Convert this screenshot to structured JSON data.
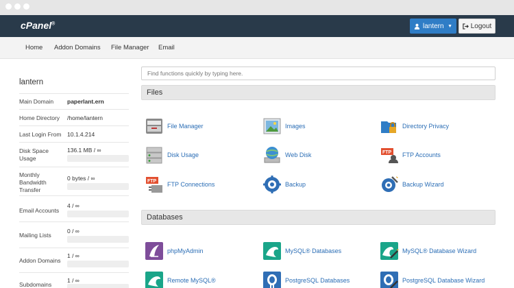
{
  "brand": {
    "logo": "cPanel",
    "mark": "®"
  },
  "header": {
    "username": "lantern",
    "logout_label": "Logout"
  },
  "nav": [
    "Home",
    "Addon Domains",
    "File Manager",
    "Email"
  ],
  "sidebar": {
    "username": "lantern",
    "stats": [
      {
        "label": "Main Domain",
        "value": "paperlant.ern",
        "bold": true
      },
      {
        "label": "Home Directory",
        "value": "/home/lantern"
      },
      {
        "label": "Last Login From",
        "value": "10.1.4.214"
      },
      {
        "label": "Disk Space Usage",
        "value": "136.1 MB / ∞",
        "usage": 0
      },
      {
        "label": "Monthly Bandwidth Transfer",
        "value": "0 bytes / ∞",
        "usage": 0
      },
      {
        "label": "Email Accounts",
        "value": "4 / ∞",
        "usage": 0
      },
      {
        "label": "Mailing Lists",
        "value": "0 / ∞",
        "usage": 0
      },
      {
        "label": "Addon Domains",
        "value": "1 / ∞",
        "usage": 0
      },
      {
        "label": "Subdomains",
        "value": "1 / ∞",
        "usage": 0
      }
    ]
  },
  "search": {
    "placeholder": "Find functions quickly by typing here."
  },
  "sections": {
    "files": {
      "title": "Files",
      "items": [
        {
          "label": "File Manager",
          "icon": "file-manager-icon"
        },
        {
          "label": "Images",
          "icon": "images-icon"
        },
        {
          "label": "Directory Privacy",
          "icon": "directory-privacy-icon"
        },
        {
          "label": "Disk Usage",
          "icon": "disk-usage-icon"
        },
        {
          "label": "Web Disk",
          "icon": "web-disk-icon"
        },
        {
          "label": "FTP Accounts",
          "icon": "ftp-accounts-icon"
        },
        {
          "label": "FTP Connections",
          "icon": "ftp-connections-icon"
        },
        {
          "label": "Backup",
          "icon": "backup-icon"
        },
        {
          "label": "Backup Wizard",
          "icon": "backup-wizard-icon"
        }
      ]
    },
    "databases": {
      "title": "Databases",
      "items": [
        {
          "label": "phpMyAdmin",
          "icon": "phpmyadmin-icon"
        },
        {
          "label": "MySQL® Databases",
          "icon": "mysql-databases-icon"
        },
        {
          "label": "MySQL® Database Wizard",
          "icon": "mysql-database-wizard-icon"
        },
        {
          "label": "Remote MySQL®",
          "icon": "remote-mysql-icon"
        },
        {
          "label": "PostgreSQL Databases",
          "icon": "postgresql-databases-icon"
        },
        {
          "label": "PostgreSQL Database Wizard",
          "icon": "postgresql-database-wizard-icon"
        }
      ]
    }
  },
  "colors": {
    "topbar": "#293a4a",
    "accent": "#2f7dc6",
    "link": "#2a6db5",
    "mysql": "#1aa589",
    "php": "#7e4d9a"
  }
}
